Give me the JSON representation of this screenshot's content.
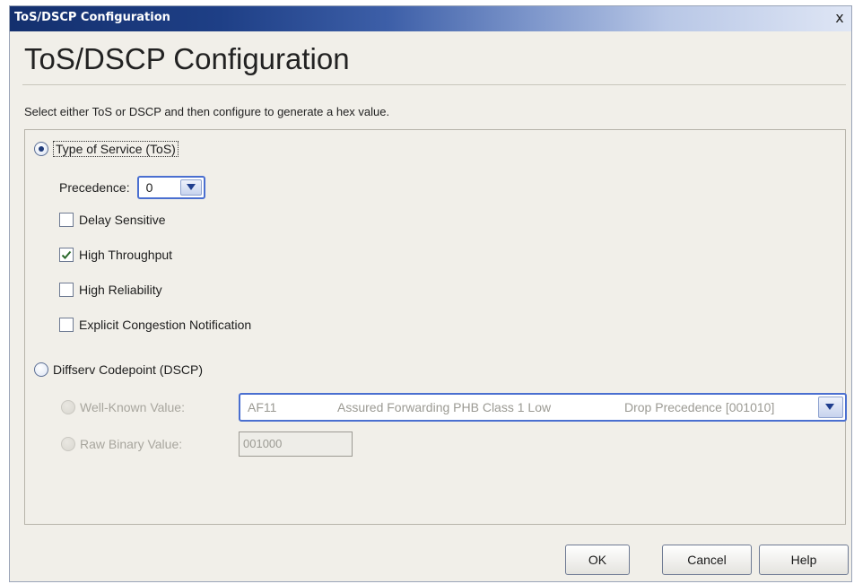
{
  "window": {
    "title": "ToS/DSCP Configuration",
    "close_glyph": "x"
  },
  "heading": "ToS/DSCP Configuration",
  "instructions": "Select either ToS or DSCP and then configure to generate a hex value.",
  "tos": {
    "label": "Type of Service (ToS)",
    "selected": true,
    "precedence_label": "Precedence:",
    "precedence_value": "0",
    "options": [
      {
        "label": "Delay Sensitive",
        "checked": false
      },
      {
        "label": "High Throughput",
        "checked": true
      },
      {
        "label": "High Reliability",
        "checked": false
      },
      {
        "label": "Explicit Congestion Notification",
        "checked": false
      }
    ]
  },
  "dscp": {
    "label": "Diffserv Codepoint (DSCP)",
    "selected": false,
    "well_known_label": "Well-Known Value:",
    "well_known_value": {
      "code": "AF11",
      "description": "Assured Forwarding PHB Class 1 Low",
      "precedence": "Drop Precedence [001010]"
    },
    "raw_binary_label": "Raw Binary Value:",
    "raw_binary_value": "001000"
  },
  "buttons": {
    "ok": "OK",
    "cancel": "Cancel",
    "help": "Help"
  },
  "colors": {
    "accent": "#4a6fd0",
    "titlebar": "#14306e",
    "background": "#f1efe9"
  }
}
